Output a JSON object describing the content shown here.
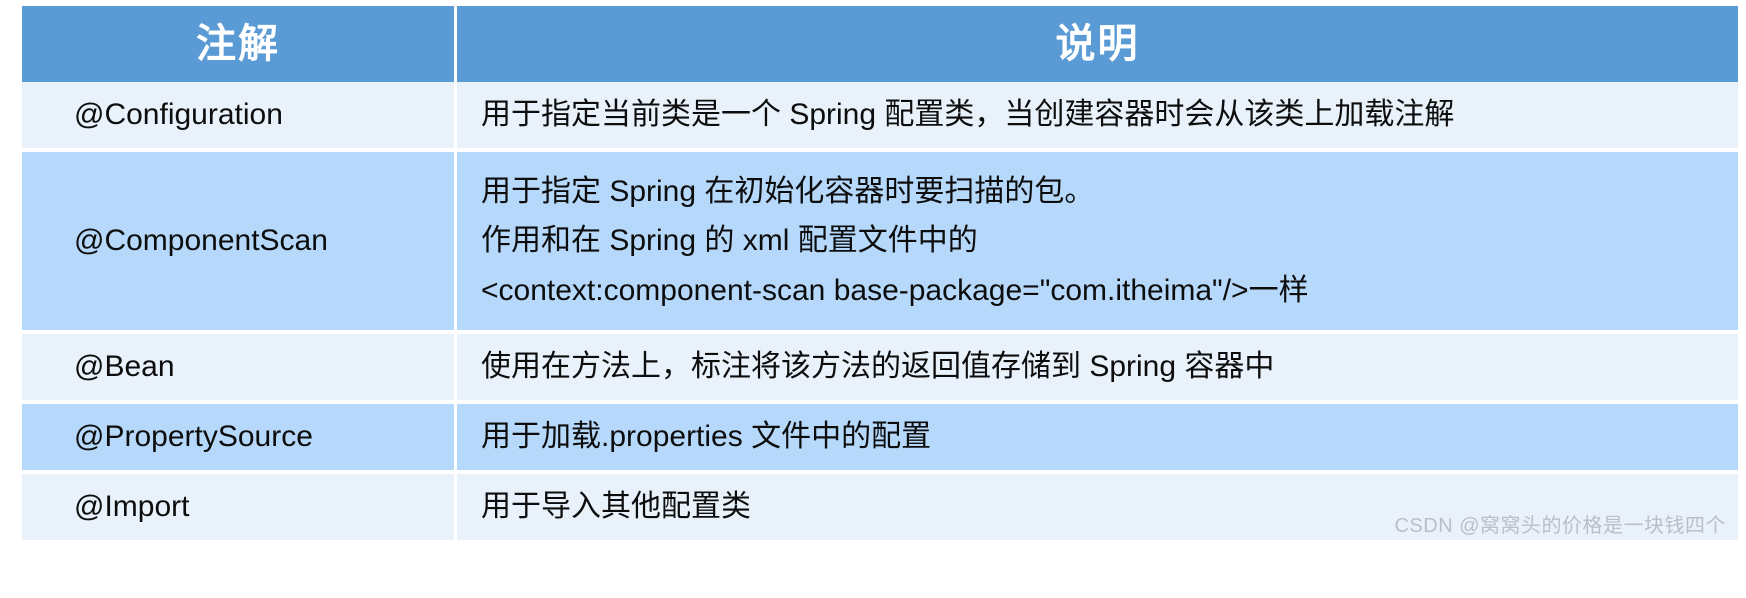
{
  "table": {
    "headers": {
      "annotation": "注解",
      "description": "说明"
    },
    "rows": [
      {
        "annotation": "@Configuration",
        "description_lines": [
          "用于指定当前类是一个 Spring 配置类，当创建容器时会从该类上加载注解"
        ]
      },
      {
        "annotation": "@ComponentScan",
        "description_lines": [
          "用于指定 Spring 在初始化容器时要扫描的包。",
          "作用和在 Spring 的 xml 配置文件中的",
          "<context:component-scan  base-package=\"com.itheima\"/>一样"
        ]
      },
      {
        "annotation": "@Bean",
        "description_lines": [
          "使用在方法上，标注将该方法的返回值存储到 Spring 容器中"
        ]
      },
      {
        "annotation": "@PropertySource",
        "description_lines": [
          "用于加载.properties  文件中的配置"
        ]
      },
      {
        "annotation": "@Import",
        "description_lines": [
          "用于导入其他配置类"
        ]
      }
    ]
  },
  "watermark": {
    "text": "CSDN @窝窝头的价格是一块钱四个"
  },
  "colors": {
    "header_bg": "#5b9bd5",
    "header_text": "#ffffff",
    "row_light_bg": "#e9f2fb",
    "row_dark_bg": "#b5d8fb",
    "body_text": "#0d0d0d",
    "watermark_text": "#b9bfc6"
  }
}
